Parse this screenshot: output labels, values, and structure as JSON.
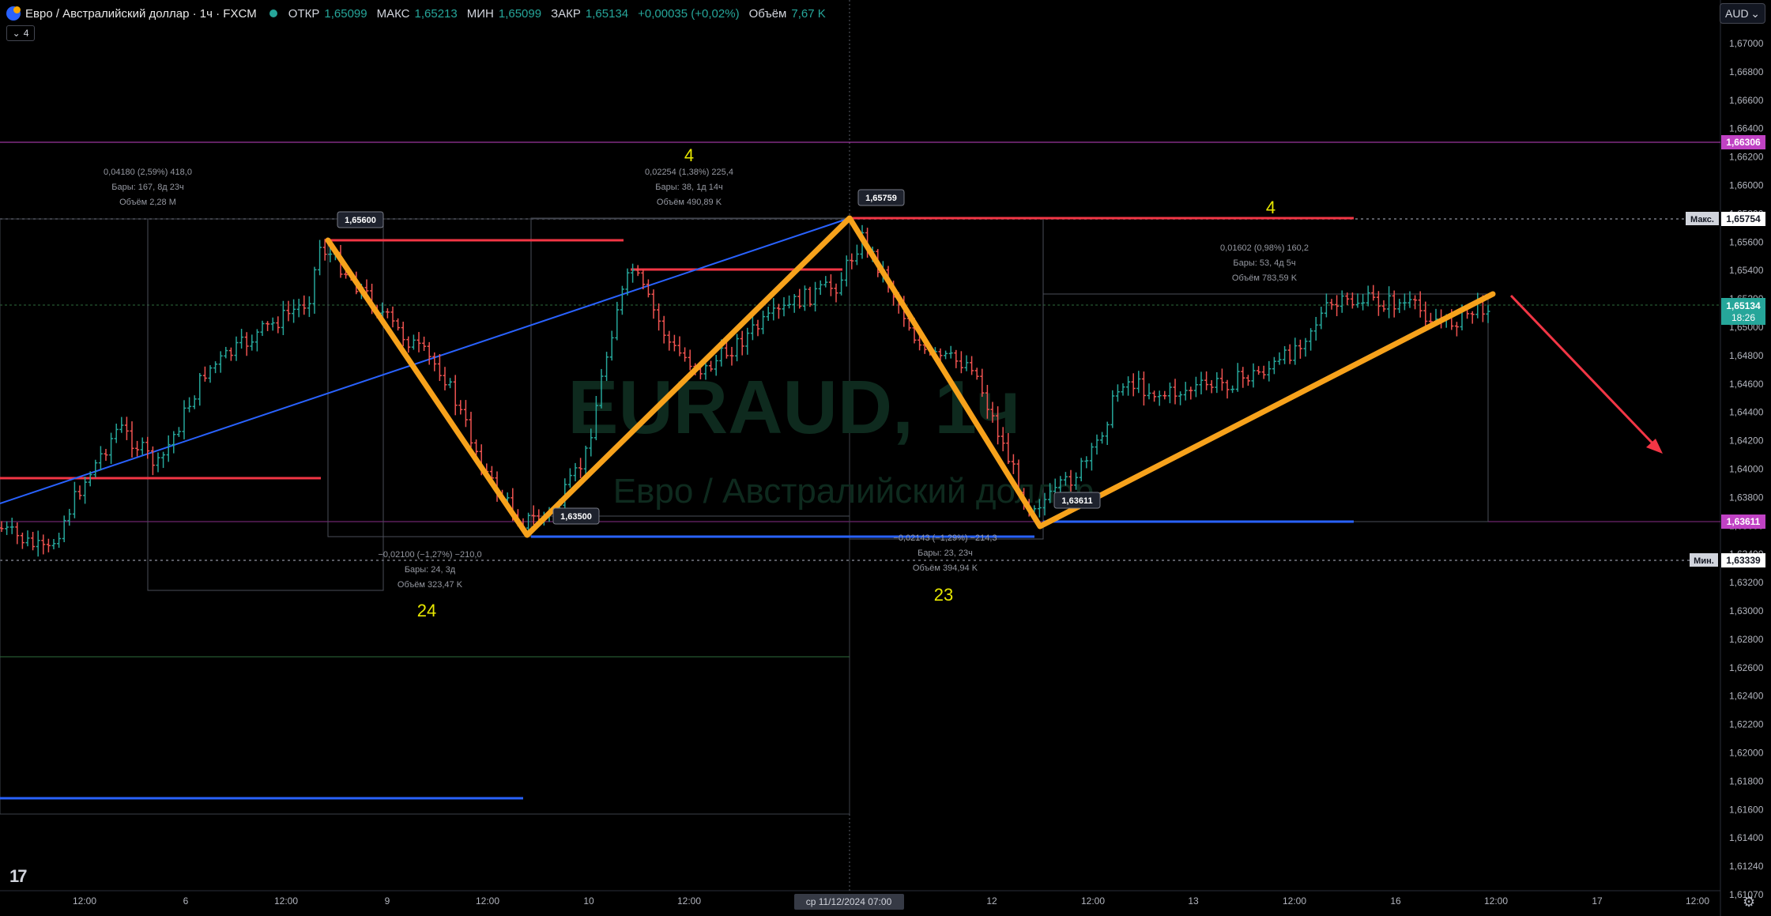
{
  "header": {
    "symbol_title": "Евро / Австралийский доллар · 1ч · FXCM",
    "open_label": "ОТКР",
    "open_value": "1,65099",
    "high_label": "МАКС",
    "high_value": "1,65213",
    "low_label": "МИН",
    "low_value": "1,65099",
    "close_label": "ЗАКР",
    "close_value": "1,65134",
    "change_value": "+0,00035 (+0,02%)",
    "volume_label": "Объём",
    "volume_value": "7,67 K",
    "indicator_count": "4"
  },
  "currency_button": "AUD",
  "watermark": {
    "ticker": "EURAUD, 1ч",
    "name": "Евро / Австралийский доллар"
  },
  "price_axis": {
    "ticks": [
      "1,67000",
      "1,66800",
      "1,66600",
      "1,66400",
      "1,66200",
      "1,66000",
      "1,65800",
      "1,65600",
      "1,65400",
      "1,65200",
      "1,65000",
      "1,64800",
      "1,64600",
      "1,64400",
      "1,64200",
      "1,64000",
      "1,63800",
      "1,63600",
      "1,63400",
      "1,63200",
      "1,63000",
      "1,62800",
      "1,62600",
      "1,62400",
      "1,62200",
      "1,62000",
      "1,61800",
      "1,61600",
      "1,61400",
      "1,61240",
      "1,61070"
    ],
    "badges": [
      {
        "text": "1,66306",
        "color": "#c042c4"
      },
      {
        "prefix": "Макс.",
        "text": "1,65754",
        "color": "#ffffff"
      },
      {
        "text": "1,65134",
        "sub": "18:26",
        "color": "#26a69a"
      },
      {
        "text": "1,63611",
        "color": "#c042c4"
      },
      {
        "prefix": "Мин.",
        "text": "1,63339",
        "color": "#ffffff"
      }
    ]
  },
  "time_axis": {
    "labels": [
      "12:00",
      "6",
      "12:00",
      "9",
      "12:00",
      "10",
      "12:00",
      "11",
      "12",
      "12:00",
      "13",
      "12:00",
      "16",
      "12:00",
      "17",
      "12:00"
    ],
    "crosshair_label": "ср 11/12/2024  07:00"
  },
  "annotations": {
    "wave_counts": [
      "4",
      "4",
      "24",
      "23"
    ],
    "measure_1": [
      "0,04180 (2,59%) 418,0",
      "Бары: 167, 8д 23ч",
      "Объём 2,28 M"
    ],
    "measure_2": [
      "0,02254 (1,38%) 225,4",
      "Бары: 38, 1д 14ч",
      "Объём 490,89 K"
    ],
    "measure_3": [
      "−0,02100 (−1,27%) −210,0",
      "Бары: 24, 3д",
      "Объём 323,47 K"
    ],
    "measure_4": [
      "−0,02143 (−1,29%) −214,3",
      "Бары: 23, 23ч",
      "Объём 394,94 K"
    ],
    "measure_5": [
      "0,01602 (0,98%) 160,2",
      "Бары: 53, 4д 5ч",
      "Объём 783,59 K"
    ],
    "pivot_labels": [
      "1,65600",
      "1,65759",
      "1,63500",
      "1,63611"
    ]
  },
  "chart_data": {
    "type": "candlestick",
    "symbol": "EURAUD",
    "timeframe": "1h",
    "ylim": [
      1.6107,
      1.671
    ],
    "pivots": [
      {
        "label": "1,65600",
        "price": 1.656
      },
      {
        "label": "1,63500",
        "price": 1.635
      },
      {
        "label": "1,65759",
        "price": 1.65759
      },
      {
        "label": "1,63611",
        "price": 1.63611
      },
      {
        "label": "last",
        "price": 1.6522
      }
    ],
    "horizontal_levels": [
      1.66306,
      1.65754,
      1.65134,
      1.63611,
      1.63339
    ],
    "colors": {
      "up": "#26a69a",
      "down": "#ef5350",
      "zigzag": "#f7a21b",
      "trend": "#2962ff",
      "level_red": "#f23645",
      "level_blue": "#2962ff",
      "magenta": "#c042c4"
    }
  }
}
